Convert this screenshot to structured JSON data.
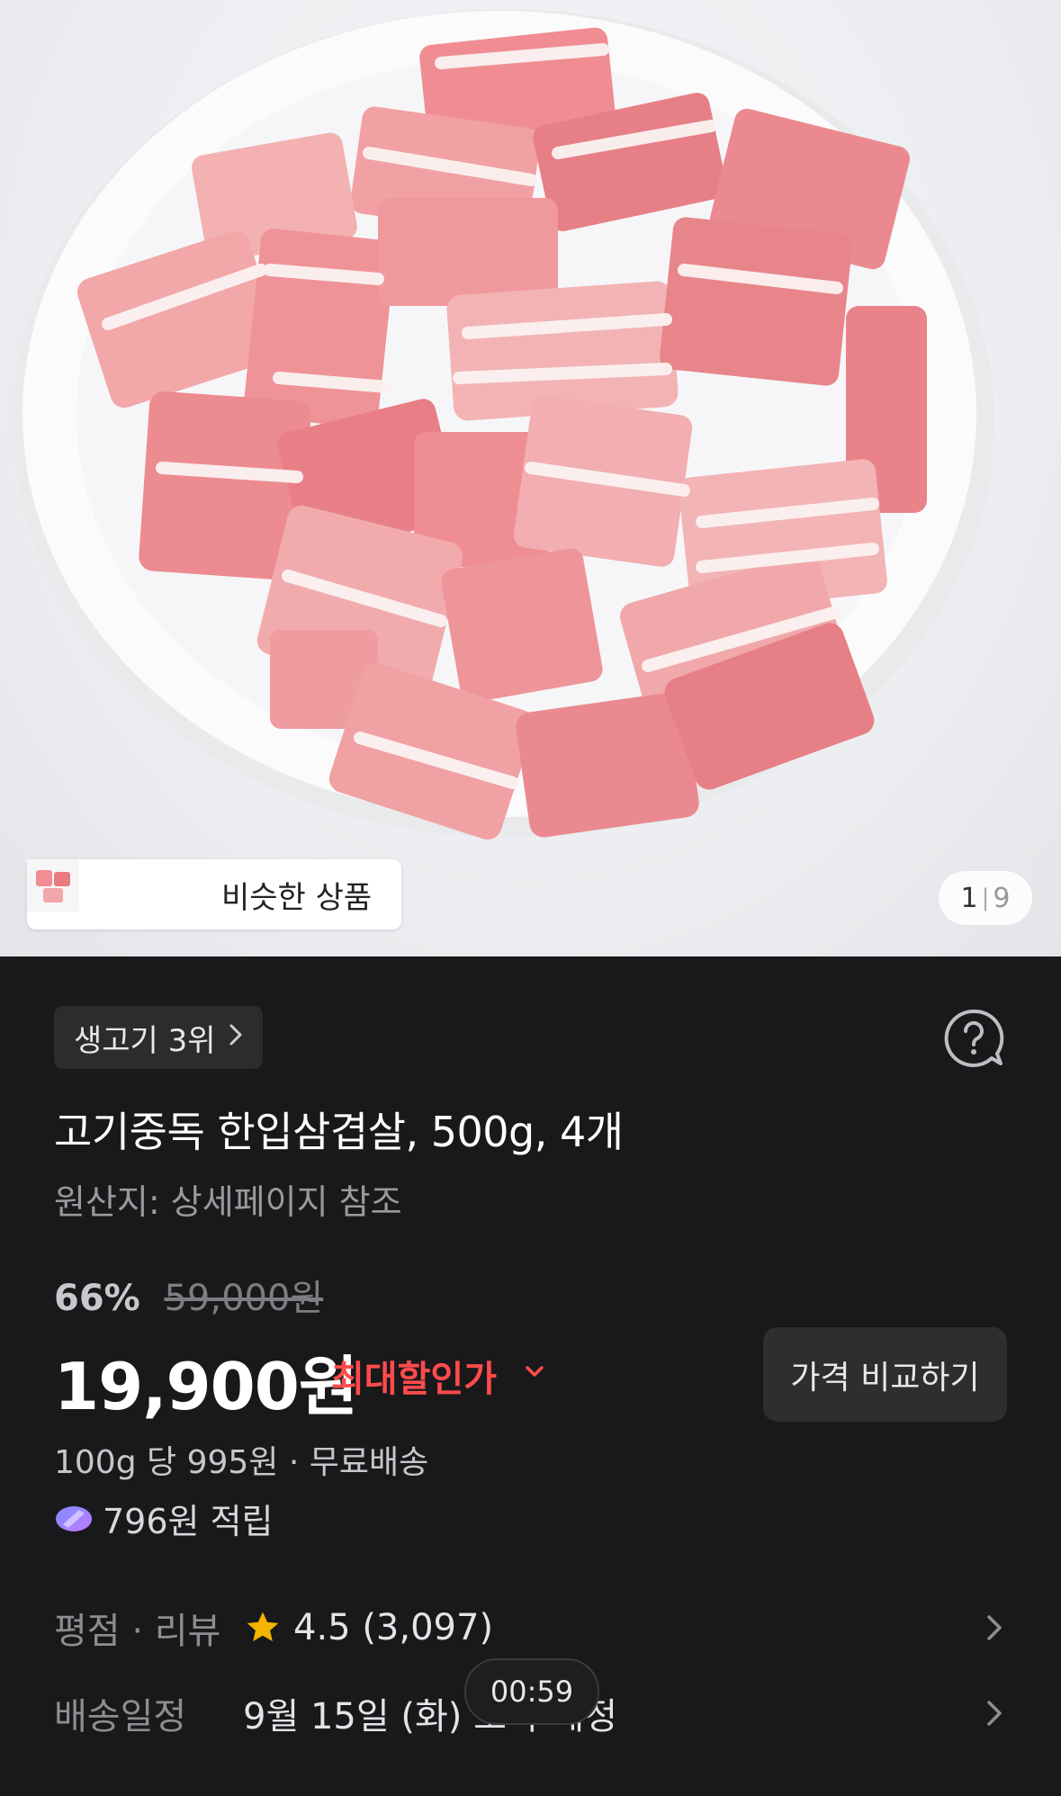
{
  "gallery": {
    "similar_label": "비슷한 상품",
    "page_current": "1",
    "page_separator": "|",
    "page_total": "9"
  },
  "product": {
    "rank_label": "생고기 3위",
    "title": "고기중독 한입삼겹살, 500g, 4개",
    "origin": "원산지: 상세페이지 참조",
    "discount_rate": "66%",
    "original_price": "59,000원",
    "price": "19,900원",
    "price_tag": "최대할인가",
    "compare_button": "가격 비교하기",
    "unit_price": "100g 당 995원 · 무료배송",
    "points": "796원 적립"
  },
  "info_rows": {
    "rating_label": "평점 · 리뷰",
    "rating_value": "4.5 (3,097)",
    "delivery_label": "배송일정",
    "delivery_value": "9월 15일 (화) 도착 예정"
  },
  "overlay": {
    "timer": "00:59"
  },
  "colors": {
    "background": "#19191b",
    "accent_red": "#ff4b4b",
    "star": "#f5b400"
  }
}
